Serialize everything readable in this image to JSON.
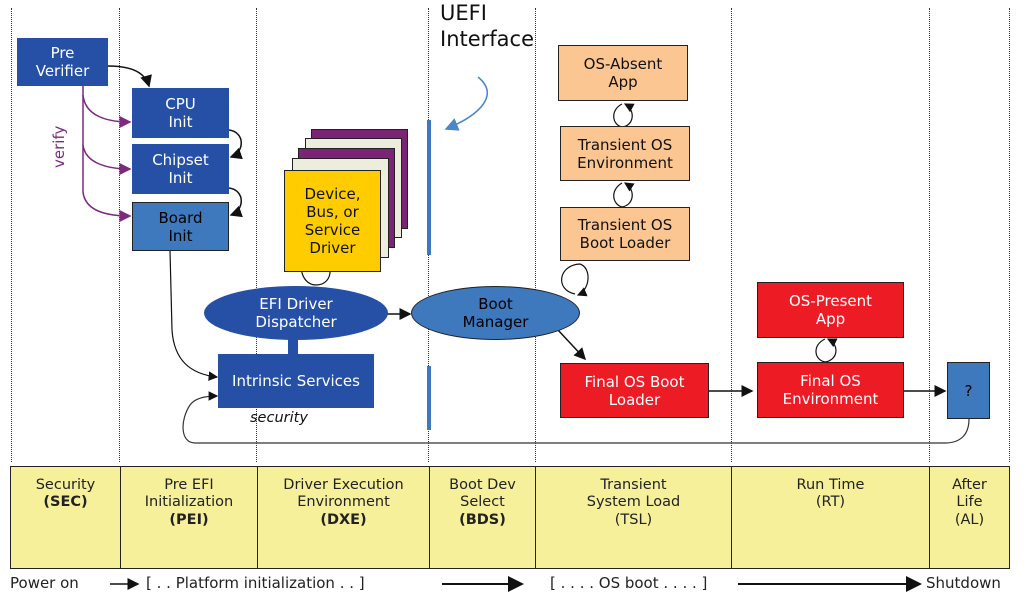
{
  "diagram": {
    "title_label": {
      "line1": "UEFI",
      "line2": "Interface"
    },
    "sec": {
      "pre_verifier": {
        "line1": "Pre",
        "line2": "Verifier"
      },
      "verify_label": "verify"
    },
    "pei": {
      "cpu_init": {
        "line1": "CPU",
        "line2": "Init"
      },
      "chipset_init": {
        "line1": "Chipset",
        "line2": "Init"
      },
      "board_init": {
        "line1": "Board",
        "line2": "Init"
      }
    },
    "dxe": {
      "driver": {
        "line1": "Device,",
        "line2": "Bus, or",
        "line3": "Service",
        "line4": "Driver"
      },
      "dispatcher": {
        "line1": "EFI Driver",
        "line2": "Dispatcher"
      },
      "intrinsic_services": "Intrinsic Services",
      "security_label": "security"
    },
    "bds": {
      "boot_manager": {
        "line1": "Boot",
        "line2": "Manager"
      }
    },
    "tsl": {
      "os_absent_app": {
        "line1": "OS-Absent",
        "line2": "App"
      },
      "transient_os_env": {
        "line1": "Transient OS",
        "line2": "Environment"
      },
      "transient_os_loader": {
        "line1": "Transient OS",
        "line2": "Boot Loader"
      },
      "final_os_loader": {
        "line1": "Final OS Boot",
        "line2": "Loader"
      }
    },
    "rt": {
      "os_present_app": {
        "line1": "OS-Present",
        "line2": "App"
      },
      "final_os_env": {
        "line1": "Final OS",
        "line2": "Environment"
      }
    },
    "al": {
      "unknown": "?"
    },
    "colors": {
      "dark_blue": "#2550a6",
      "medium_blue": "#3e78bd",
      "orange": "#fbc691",
      "red": "#ed1c24",
      "yellow_driver": "#ffcc00",
      "purple": "#7b2a7e",
      "phase_band": "#f7f09a"
    }
  },
  "phases": [
    {
      "line1": "Security",
      "line2": "",
      "abbr": "(SEC)"
    },
    {
      "line1": "Pre EFI",
      "line2": "Initialization",
      "abbr": "(PEI)"
    },
    {
      "line1": "Driver Execution",
      "line2": "Environment",
      "abbr": "(DXE)"
    },
    {
      "line1": "Boot Dev",
      "line2": "Select",
      "abbr": "(BDS)"
    },
    {
      "line1": "Transient",
      "line2": "System Load",
      "abbr": "(TSL)"
    },
    {
      "line1": "Run Time",
      "line2": "",
      "abbr": "(RT)"
    },
    {
      "line1": "After",
      "line2": "Life",
      "abbr": "(AL)"
    }
  ],
  "footer": {
    "power_on": "Power on",
    "platform_init": "[ . . Platform initialization . . ]",
    "os_boot": "[ . . . . OS boot . . . . ]",
    "shutdown": "Shutdown"
  }
}
